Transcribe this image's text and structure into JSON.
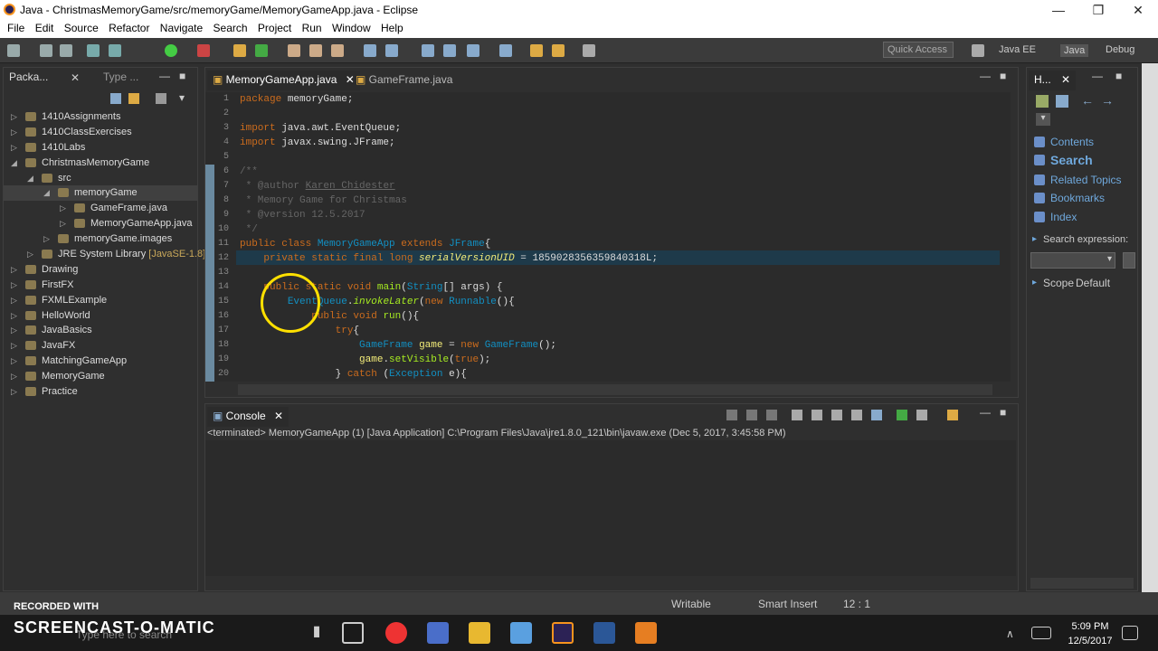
{
  "window": {
    "title": "Java - ChristmasMemoryGame/src/memoryGame/MemoryGameApp.java - Eclipse"
  },
  "menu": [
    "File",
    "Edit",
    "Source",
    "Refactor",
    "Navigate",
    "Search",
    "Project",
    "Run",
    "Window",
    "Help"
  ],
  "toolbar": {
    "quick_access_placeholder": "Quick Access",
    "perspectives": [
      "Java EE",
      "Java",
      "Debug"
    ]
  },
  "package_explorer": {
    "tabs": [
      "Packa...",
      "Type ..."
    ],
    "items": [
      {
        "label": "1410Assignments",
        "depth": 0,
        "expanded": false
      },
      {
        "label": "1410ClassExercises",
        "depth": 0,
        "expanded": false
      },
      {
        "label": "1410Labs",
        "depth": 0,
        "expanded": false
      },
      {
        "label": "ChristmasMemoryGame",
        "depth": 0,
        "expanded": true
      },
      {
        "label": "src",
        "depth": 1,
        "expanded": true
      },
      {
        "label": "memoryGame",
        "depth": 2,
        "expanded": true,
        "selected": true
      },
      {
        "label": "GameFrame.java",
        "depth": 3,
        "expanded": false
      },
      {
        "label": "MemoryGameApp.java",
        "depth": 3,
        "expanded": false
      },
      {
        "label": "memoryGame.images",
        "depth": 2,
        "expanded": false
      },
      {
        "label": "JRE System Library",
        "suffix": "[JavaSE-1.8]",
        "depth": 1,
        "expanded": false
      },
      {
        "label": "Drawing",
        "depth": 0,
        "expanded": false
      },
      {
        "label": "FirstFX",
        "depth": 0,
        "expanded": false
      },
      {
        "label": "FXMLExample",
        "depth": 0,
        "expanded": false
      },
      {
        "label": "HelloWorld",
        "depth": 0,
        "expanded": false
      },
      {
        "label": "JavaBasics",
        "depth": 0,
        "expanded": false
      },
      {
        "label": "JavaFX",
        "depth": 0,
        "expanded": false
      },
      {
        "label": "MatchingGameApp",
        "depth": 0,
        "expanded": false
      },
      {
        "label": "MemoryGame",
        "depth": 0,
        "expanded": false
      },
      {
        "label": "Practice",
        "depth": 0,
        "expanded": false
      }
    ]
  },
  "editor": {
    "tabs": [
      "MemoryGameApp.java",
      "GameFrame.java"
    ],
    "line_numbers": [
      "1",
      "2",
      "3",
      "4",
      "5",
      "6",
      "7",
      "8",
      "9",
      "10",
      "11",
      "12",
      "13",
      "14",
      "15",
      "16",
      "17",
      "18",
      "19",
      "20"
    ]
  },
  "console": {
    "tab": "Console",
    "status": "<terminated> MemoryGameApp (1) [Java Application] C:\\Program Files\\Java\\jre1.8.0_121\\bin\\javaw.exe (Dec 5, 2017, 3:45:58 PM)"
  },
  "help": {
    "tab": "H...",
    "links": [
      "Contents",
      "Search",
      "Related Topics",
      "Bookmarks",
      "Index"
    ],
    "search_expression_label": "Search expression:",
    "scope_label": "Scope",
    "scope_value": "Default"
  },
  "statusbar": {
    "writable": "Writable",
    "insert_mode": "Smart Insert",
    "position": "12 : 1"
  },
  "overlay": {
    "recorded_with": "RECORDED WITH",
    "brand": "SCREENCAST-O-MATIC"
  },
  "taskbar": {
    "search_placeholder": "Type here to search",
    "time": "5:09 PM",
    "date": "12/5/2017"
  }
}
